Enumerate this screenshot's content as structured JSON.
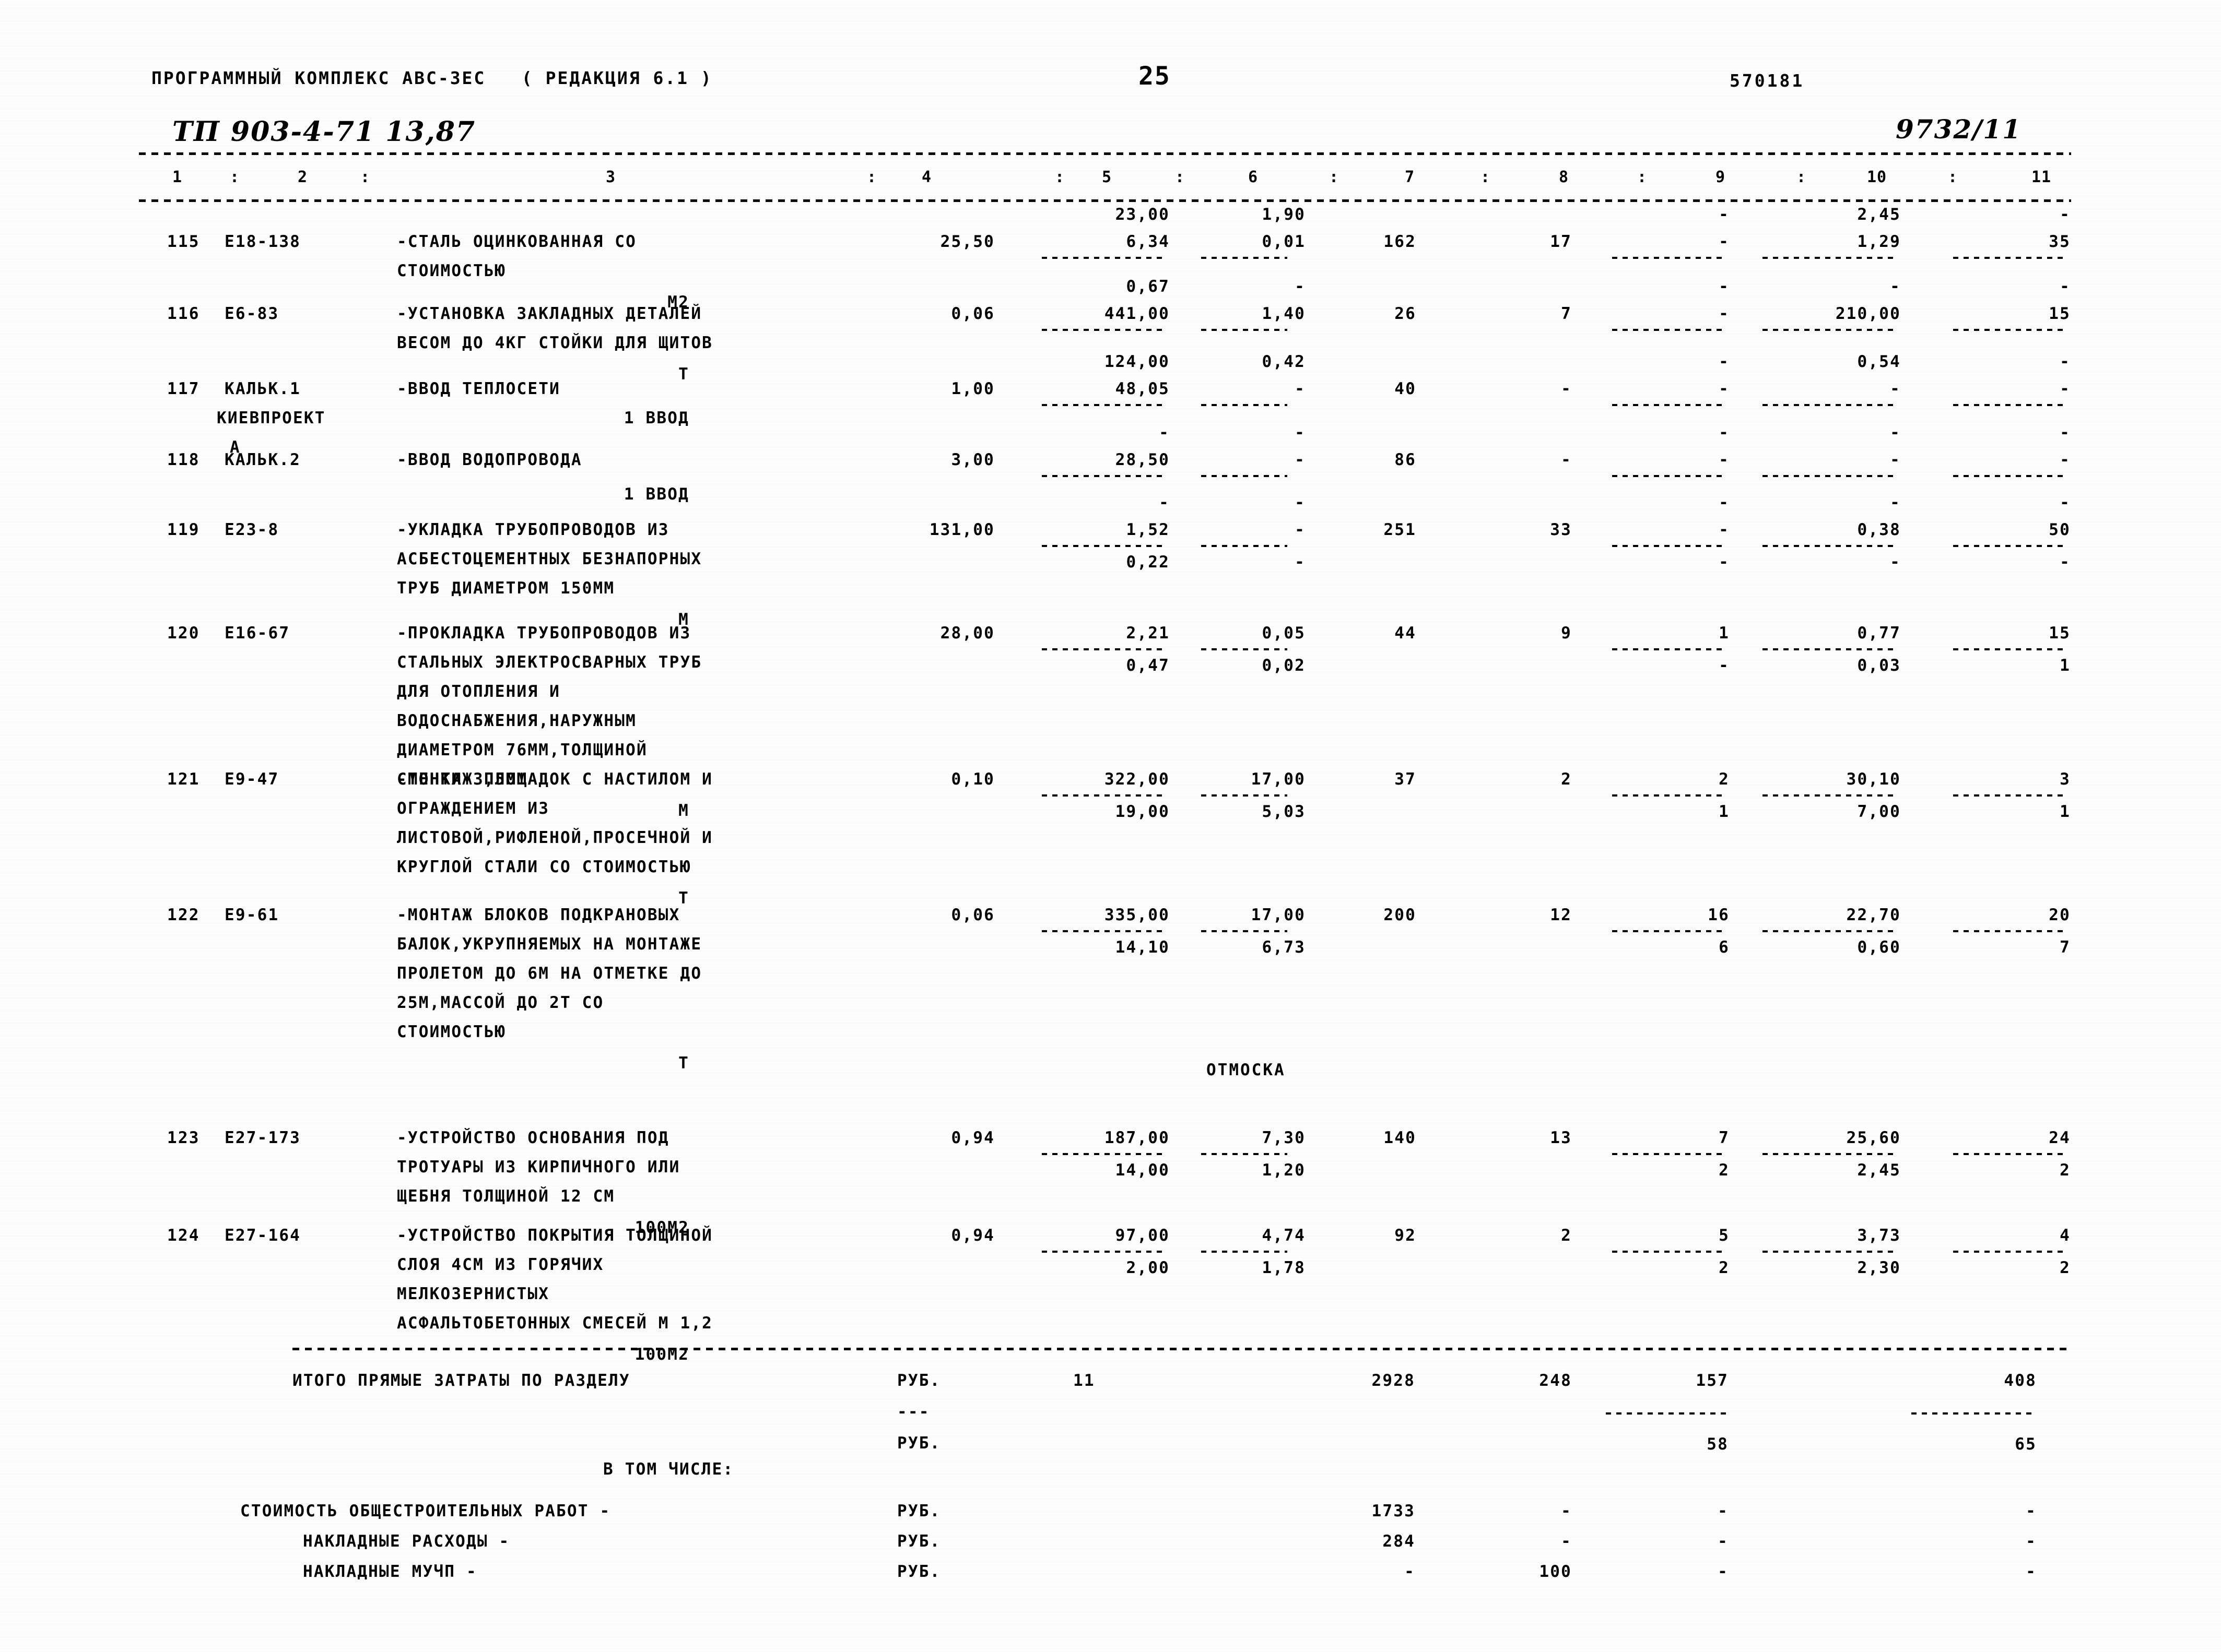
{
  "header": {
    "program_line": "ПРОГРАММНЫЙ КОМПЛЕКС АВС-ЗЕС   ( РЕДАКЦИЯ 6.1 )",
    "page_number": "25",
    "doc_number": "570181",
    "handwritten_left": "ТП 903-4-71 13,87",
    "handwritten_right": "9732/11"
  },
  "column_numbers": [
    "1",
    "2",
    "3",
    "4",
    "5",
    "6",
    "7",
    "8",
    "9",
    "10",
    "11"
  ],
  "column_separators": [
    ":",
    ":",
    ":",
    ":",
    ":",
    ":",
    ":",
    ":",
    ":",
    ":"
  ],
  "rows": [
    {
      "num": "115",
      "code": "E18-138",
      "desc": [
        "-СТАЛЬ ОЦИНКОВАННАЯ СО",
        "СТОИМОСТЬЮ"
      ],
      "unit": "М2",
      "c4": "25,50",
      "c5_top": "23,00",
      "c5_main": "6,34",
      "c5_bot": "",
      "c6_top": "1,90",
      "c6_main": "0,01",
      "c6_bot": "",
      "c7": "162",
      "c8": "17",
      "c9_top": "-",
      "c9_main": "-",
      "c9_bot": "",
      "c10_top": "2,45",
      "c10_main": "1,29",
      "c10_bot": "",
      "c11_top": "-",
      "c11_main": "35",
      "c11_bot": ""
    },
    {
      "num": "116",
      "code": "E6-83",
      "desc": [
        "-УСТАНОВКА ЗАКЛАДНЫХ ДЕТАЛЕЙ",
        "ВЕСОМ ДО 4КГ СТОЙКИ ДЛЯ ЩИТОВ"
      ],
      "unit": "Т",
      "c4": "0,06",
      "c5_top": "0,67",
      "c5_main": "441,00",
      "c6_top": "-",
      "c6_main": "1,40",
      "c7": "26",
      "c8": "7",
      "c9_top": "-",
      "c9_main": "-",
      "c10_top": "-",
      "c10_main": "210,00",
      "c11_top": "-",
      "c11_main": "15"
    },
    {
      "num": "117",
      "code": "КАЛЬК.1",
      "code2": "КИЕВПРОЕКТ",
      "code3": "А",
      "desc": [
        "-ВВОД ТЕПЛОСЕТИ"
      ],
      "unit": "1 ВВОД",
      "c4": "1,00",
      "c5_top": "124,00",
      "c5_main": "48,05",
      "c6_top": "0,42",
      "c6_main": "-",
      "c7": "40",
      "c8": "-",
      "c9_top": "-",
      "c9_main": "-",
      "c10_top": "0,54",
      "c10_main": "-",
      "c11_top": "-",
      "c11_main": "-"
    },
    {
      "num": "118",
      "code": "КАЛЬК.2",
      "desc": [
        "-ВВОД ВОДОПРОВОДА"
      ],
      "unit": "1 ВВОД",
      "c4": "3,00",
      "c5_top": "-",
      "c5_main": "28,50",
      "c6_top": "-",
      "c6_main": "-",
      "c7": "86",
      "c8": "-",
      "c9_top": "-",
      "c9_main": "-",
      "c10_top": "-",
      "c10_main": "-",
      "c11_top": "-",
      "c11_main": "-"
    },
    {
      "num": "119",
      "code": "E23-8",
      "desc": [
        "-УКЛАДКА ТРУБОПРОВОДОВ ИЗ",
        "АСБЕСТОЦЕМЕНТНЫХ БЕЗНАПОРНЫХ",
        "ТРУБ ДИАМЕТРОМ 150ММ"
      ],
      "unit": "М",
      "c4": "131,00",
      "c5_top": "-",
      "c5_main": "1,52",
      "c5_bot": "0,22",
      "c6_top": "-",
      "c6_main": "-",
      "c6_bot": "-",
      "c7": "251",
      "c8": "33",
      "c9_top": "-",
      "c9_main": "-",
      "c9_bot": "-",
      "c10_top": "-",
      "c10_main": "0,38",
      "c10_bot": "-",
      "c11_top": "-",
      "c11_main": "50",
      "c11_bot": "-"
    },
    {
      "num": "120",
      "code": "E16-67",
      "desc": [
        "-ПРОКЛАДКА ТРУБОПРОВОДОВ ИЗ",
        "СТАЛЬНЫХ ЭЛЕКТРОСВАРНЫХ ТРУБ",
        "ДЛЯ ОТОПЛЕНИЯ И",
        "ВОДОСНАБЖЕНИЯ,НАРУЖНЫМ",
        "ДИАМЕТРОМ 76ММ,ТОЛЩИНОЙ",
        "СТЕНКИ 3,5ММ"
      ],
      "unit": "М",
      "c4": "28,00",
      "c5_main": "2,21",
      "c5_bot": "0,47",
      "c6_main": "0,05",
      "c6_bot": "0,02",
      "c7": "44",
      "c8": "9",
      "c9_main": "1",
      "c9_bot": "-",
      "c10_main": "0,77",
      "c10_bot": "0,03",
      "c11_main": "15",
      "c11_bot": "1"
    },
    {
      "num": "121",
      "code": "E9-47",
      "desc": [
        "-МОНТАЖ ПЛОЩАДОК С НАСТИЛОМ И",
        "ОГРАЖДЕНИЕМ ИЗ",
        "ЛИСТОВОЙ,РИФЛЕНОЙ,ПРОСЕЧНОЙ И",
        "КРУГЛОЙ СТАЛИ СО СТОИМОСТЬЮ"
      ],
      "unit": "Т",
      "c4": "0,10",
      "c5_main": "322,00",
      "c5_bot": "19,00",
      "c6_main": "17,00",
      "c6_bot": "5,03",
      "c7": "37",
      "c8": "2",
      "c9_main": "2",
      "c9_bot": "1",
      "c10_main": "30,10",
      "c10_bot": "7,00",
      "c11_main": "3",
      "c11_bot": "1"
    },
    {
      "num": "122",
      "code": "E9-61",
      "desc": [
        "-МОНТАЖ БЛОКОВ ПОДКРАНОВЫХ",
        "БАЛОК,УКРУПНЯЕМЫХ НА МОНТАЖЕ",
        "ПРОЛЕТОМ ДО 6М НА ОТМЕТКЕ ДО",
        "25М,МАССОЙ ДО 2Т СО",
        "СТОИМОСТЬЮ"
      ],
      "unit": "Т",
      "c4": "0,06",
      "c5_main": "335,00",
      "c5_bot": "14,10",
      "c6_main": "17,00",
      "c6_bot": "6,73",
      "c7": "200",
      "c8": "12",
      "c9_main": "16",
      "c9_bot": "6",
      "c10_main": "22,70",
      "c10_bot": "0,60",
      "c11_main": "20",
      "c11_bot": "7"
    },
    {
      "num": "123",
      "code": "E27-173",
      "desc": [
        "-УСТРОЙСТВО ОСНОВАНИЯ ПОД",
        "ТРОТУАРЫ ИЗ КИРПИЧНОГО ИЛИ",
        "ЩЕБНЯ ТОЛЩИНОЙ 12 СМ"
      ],
      "unit": "100М2",
      "c4": "0,94",
      "c5_main": "187,00",
      "c5_bot": "14,00",
      "c6_main": "7,30",
      "c6_bot": "1,20",
      "c7": "140",
      "c8": "13",
      "c9_main": "7",
      "c9_bot": "2",
      "c10_main": "25,60",
      "c10_bot": "2,45",
      "c11_main": "24",
      "c11_bot": "2"
    },
    {
      "num": "124",
      "code": "E27-164",
      "desc": [
        "-УСТРОЙСТВО ПОКРЫТИЯ ТОЛЩИНОЙ",
        "СЛОЯ 4СМ ИЗ ГОРЯЧИХ",
        "МЕЛКОЗЕРНИСТЫХ",
        "АСФАЛЬТОБЕТОННЫХ СМЕСЕЙ М 1,2"
      ],
      "unit": "100М2",
      "c4": "0,94",
      "c5_main": "97,00",
      "c5_bot": "2,00",
      "c6_main": "4,74",
      "c6_bot": "1,78",
      "c7": "92",
      "c8": "2",
      "c9_main": "5",
      "c9_bot": "2",
      "c10_main": "3,73",
      "c10_bot": "2,30",
      "c11_main": "4",
      "c11_bot": "2"
    }
  ],
  "annotation": {
    "otmoska": "ОТМОСКА"
  },
  "totals": {
    "label": "ИТОГО ПРЯМЫЕ ЗАТРАТЫ ПО РАЗДЕЛУ",
    "section": "11",
    "unit1": "РУБ.",
    "unit2": "РУБ.",
    "dash_marker": "---",
    "c7": "2928",
    "c8": "248",
    "c9": "157",
    "c11": "408",
    "c9_second": "58",
    "c11_second": "65",
    "in_which": "В ТОМ ЧИСЛЕ:"
  },
  "breakdown": [
    {
      "label": "СТОИМОСТЬ ОБЩЕСТРОИТЕЛЬНЫХ РАБОТ -",
      "unit": "РУБ.",
      "c7": "1733",
      "c8": "-",
      "c9": "-",
      "c11": "-"
    },
    {
      "label": "НАКЛАДНЫЕ РАСХОДЫ -",
      "unit": "РУБ.",
      "c7": "284",
      "c8": "-",
      "c9": "-",
      "c11": "-"
    },
    {
      "label": "НАКЛАДНЫЕ МУЧП -",
      "unit": "РУБ.",
      "c7": "-",
      "c8": "100",
      "c9": "-",
      "c11": "-"
    }
  ]
}
